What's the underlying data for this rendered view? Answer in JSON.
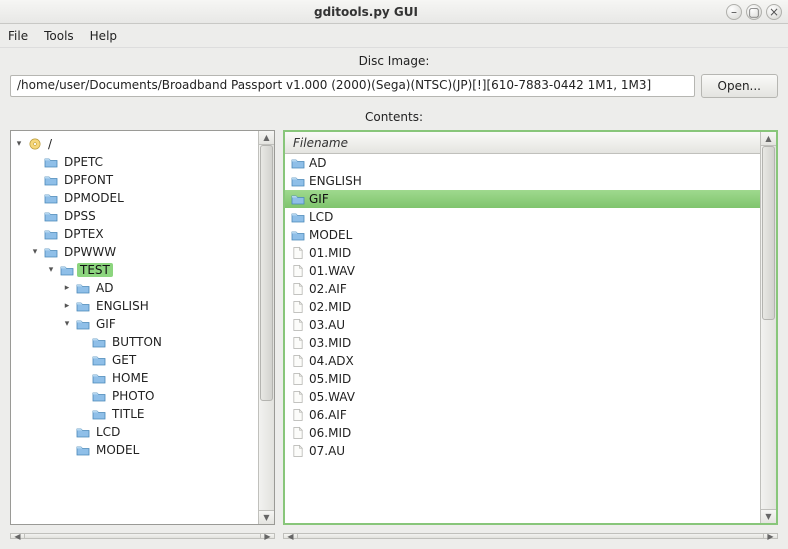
{
  "window": {
    "title": "gditools.py GUI"
  },
  "menu": [
    "File",
    "Tools",
    "Help"
  ],
  "disc": {
    "label": "Disc Image:",
    "path": "/home/user/Documents/Broadband Passport v1.000 (2000)(Sega)(NTSC)(JP)[!][610-7883-0442 1M1, 1M3]",
    "open": "Open..."
  },
  "contents": {
    "label": "Contents:"
  },
  "tree": {
    "root": "/",
    "selected": "TEST",
    "items": [
      {
        "depth": 0,
        "label": "/",
        "type": "disc",
        "twisty": "v"
      },
      {
        "depth": 1,
        "label": "DPETC",
        "type": "folder",
        "twisty": ""
      },
      {
        "depth": 1,
        "label": "DPFONT",
        "type": "folder",
        "twisty": ""
      },
      {
        "depth": 1,
        "label": "DPMODEL",
        "type": "folder",
        "twisty": ""
      },
      {
        "depth": 1,
        "label": "DPSS",
        "type": "folder",
        "twisty": ""
      },
      {
        "depth": 1,
        "label": "DPTEX",
        "type": "folder",
        "twisty": ""
      },
      {
        "depth": 1,
        "label": "DPWWW",
        "type": "folder",
        "twisty": "v"
      },
      {
        "depth": 2,
        "label": "TEST",
        "type": "folder",
        "twisty": "v",
        "selected": true
      },
      {
        "depth": 3,
        "label": "AD",
        "type": "folder",
        "twisty": ">"
      },
      {
        "depth": 3,
        "label": "ENGLISH",
        "type": "folder",
        "twisty": ">"
      },
      {
        "depth": 3,
        "label": "GIF",
        "type": "folder",
        "twisty": "v"
      },
      {
        "depth": 4,
        "label": "BUTTON",
        "type": "folder",
        "twisty": ""
      },
      {
        "depth": 4,
        "label": "GET",
        "type": "folder",
        "twisty": ""
      },
      {
        "depth": 4,
        "label": "HOME",
        "type": "folder",
        "twisty": ""
      },
      {
        "depth": 4,
        "label": "PHOTO",
        "type": "folder",
        "twisty": ""
      },
      {
        "depth": 4,
        "label": "TITLE",
        "type": "folder",
        "twisty": ""
      },
      {
        "depth": 3,
        "label": "LCD",
        "type": "folder",
        "twisty": ""
      },
      {
        "depth": 3,
        "label": "MODEL",
        "type": "folder",
        "twisty": ""
      }
    ]
  },
  "list": {
    "header": "Filename",
    "selected": "GIF",
    "items": [
      {
        "name": "AD",
        "type": "folder"
      },
      {
        "name": "ENGLISH",
        "type": "folder"
      },
      {
        "name": "GIF",
        "type": "folder",
        "selected": true
      },
      {
        "name": "LCD",
        "type": "folder"
      },
      {
        "name": "MODEL",
        "type": "folder"
      },
      {
        "name": "01.MID",
        "type": "file"
      },
      {
        "name": "01.WAV",
        "type": "file"
      },
      {
        "name": "02.AIF",
        "type": "file"
      },
      {
        "name": "02.MID",
        "type": "file"
      },
      {
        "name": "03.AU",
        "type": "file"
      },
      {
        "name": "03.MID",
        "type": "file"
      },
      {
        "name": "04.ADX",
        "type": "file"
      },
      {
        "name": "05.MID",
        "type": "file"
      },
      {
        "name": "05.WAV",
        "type": "file"
      },
      {
        "name": "06.AIF",
        "type": "file"
      },
      {
        "name": "06.MID",
        "type": "file"
      },
      {
        "name": "07.AU",
        "type": "file"
      }
    ]
  }
}
